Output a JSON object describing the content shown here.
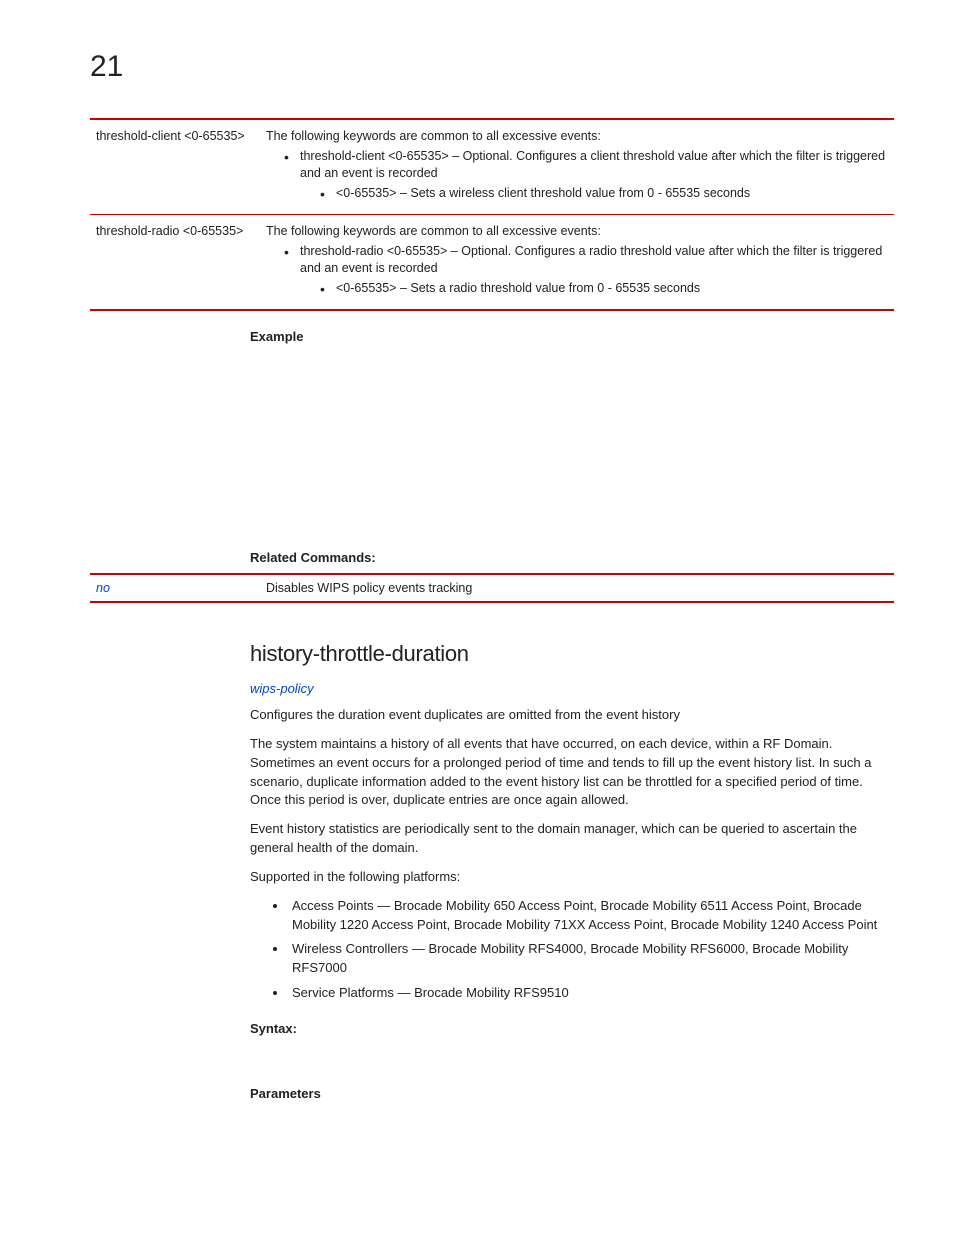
{
  "chapter": "21",
  "table1": {
    "row1": {
      "param": "threshold-client <0-65535>",
      "intro": "The following keywords are common to all excessive events:",
      "b1": "threshold-client <0-65535> – Optional. Configures a client threshold value after which the filter is triggered and an event is recorded",
      "sub1": "<0-65535> – Sets a wireless client threshold value from 0 - 65535 seconds"
    },
    "row2": {
      "param": "threshold-radio <0-65535>",
      "intro": "The following keywords are common to all excessive events:",
      "b1": "threshold-radio <0-65535> – Optional. Configures a radio threshold value after which the filter is triggered and an event is recorded",
      "sub1": "<0-65535> – Sets a radio threshold value from 0 - 65535 seconds"
    }
  },
  "labels": {
    "example": "Example",
    "related": "Related Commands:",
    "syntax": "Syntax:",
    "parameters": "Parameters"
  },
  "related": {
    "cmd": "no",
    "desc": "Disables WIPS policy events tracking"
  },
  "section": {
    "title": "history-throttle-duration",
    "link": "wips-policy",
    "p1": "Configures the duration event duplicates are omitted from the event history",
    "p2": "The system maintains a history of all events that have occurred, on each device, within a RF Domain. Sometimes an event occurs for a prolonged period of time and tends to fill up the event history list. In such a scenario, duplicate information added to the event history list can be throttled for a specified period of time. Once this period is over, duplicate entries are once again allowed.",
    "p3": "Event history statistics are periodically sent to the domain manager, which can be queried to ascertain the general health of the domain.",
    "p4": "Supported in the following platforms:",
    "plat1": "Access Points — Brocade Mobility 650 Access Point, Brocade Mobility 6511 Access Point, Brocade Mobility 1220 Access Point, Brocade Mobility 71XX Access Point, Brocade Mobility 1240 Access Point",
    "plat2": "Wireless Controllers — Brocade Mobility RFS4000, Brocade Mobility RFS6000, Brocade Mobility RFS7000",
    "plat3": "Service Platforms — Brocade Mobility RFS9510"
  }
}
